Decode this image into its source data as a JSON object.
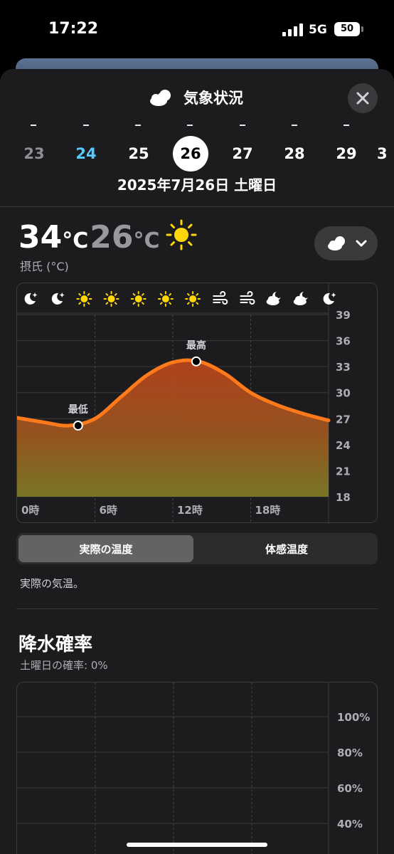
{
  "status": {
    "time": "17:22",
    "network": "5G",
    "battery": "50"
  },
  "header": {
    "title": "気象状況",
    "icon": "cloud-sun-icon",
    "close_icon": "close-icon"
  },
  "dates": {
    "items": [
      {
        "day": "23",
        "state": "past"
      },
      {
        "day": "24",
        "state": "today"
      },
      {
        "day": "25",
        "state": "future"
      },
      {
        "day": "26",
        "state": "selected"
      },
      {
        "day": "27",
        "state": "future"
      },
      {
        "day": "28",
        "state": "future"
      },
      {
        "day": "29",
        "state": "future"
      },
      {
        "day": "3",
        "state": "future"
      }
    ],
    "selected_label": "2025年7月26日 土曜日"
  },
  "summary": {
    "high": "34",
    "low": "26",
    "unit": "°C",
    "condition_icon": "sun-icon",
    "unit_label": "摂氏 (°C)",
    "view_icon": "cloud-sun-icon",
    "view_chevron": "chevron-down-icon"
  },
  "chart_data": {
    "type": "area",
    "x_tick_labels": [
      "0時",
      "6時",
      "12時",
      "18時"
    ],
    "y_ticks": [
      39,
      36,
      33,
      30,
      27,
      24,
      21,
      18
    ],
    "ylim": [
      18,
      39
    ],
    "xlim": [
      0,
      24
    ],
    "x": [
      0,
      2,
      4,
      6,
      8,
      10,
      12,
      14,
      16,
      18,
      20,
      22,
      24
    ],
    "values": [
      27.1,
      26.6,
      26.2,
      27.0,
      29.5,
      32.0,
      33.5,
      33.6,
      32.2,
      30.0,
      28.6,
      27.6,
      26.8
    ],
    "annotations": [
      {
        "label": "最低",
        "x": 4.7,
        "y": 26.2
      },
      {
        "label": "最高",
        "x": 13.8,
        "y": 33.6
      }
    ],
    "hourly_icons": [
      "moon-icon",
      "moon-icon",
      "sun-icon",
      "sun-icon",
      "sun-icon",
      "sun-icon",
      "sun-icon",
      "wind-icon",
      "wind-icon",
      "cloud-moon-icon",
      "cloud-moon-icon",
      "moon-icon"
    ],
    "colors": {
      "line": "#ff7a1a",
      "fill_top": "#b8431c",
      "fill_bottom": "#8a7a1e",
      "marker": "#000000"
    }
  },
  "toggle": {
    "options": [
      "実際の温度",
      "体感温度"
    ],
    "selected": 0
  },
  "caption": "実際の気温。",
  "precipitation": {
    "title": "降水確率",
    "subtitle": "土曜日の確率: 0%",
    "y_ticks": [
      "100%",
      "80%",
      "60%",
      "40%"
    ]
  }
}
